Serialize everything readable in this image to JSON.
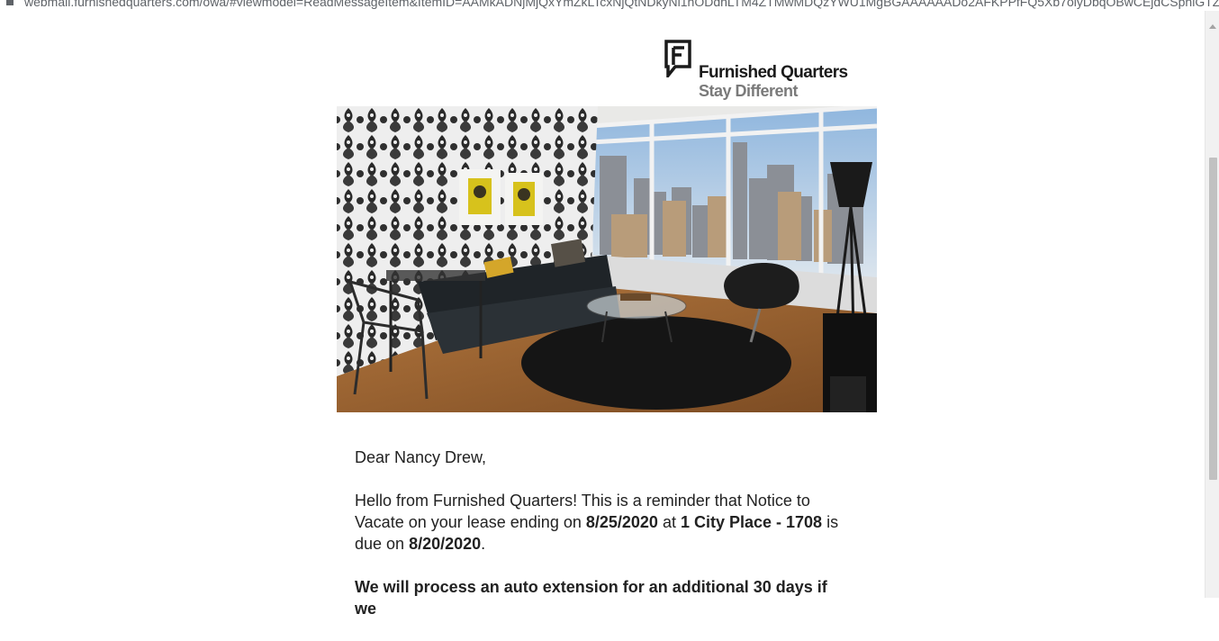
{
  "browser": {
    "url": "webmail.furnishedquarters.com/owa/#viewmodel=ReadMessageItem&ItemID=AAMkADNjMjQxYmZkLTcxNjQtNDkyNi1hODdhLTM4ZTMwMDQzYWU1MgBGAAAAAADo2AFKPPfFQ5Xb7oiyDbqOBwCEjdCSphlGTZ..."
  },
  "email": {
    "logo": {
      "name": "Furnished Quarters",
      "tagline": "Stay Different"
    },
    "greeting": "Dear Nancy Drew,",
    "para1": {
      "t1": "Hello from Furnished Quarters! This is a reminder that Notice to Vacate on your lease ending on ",
      "date_end": "8/25/2020",
      "t2": " at ",
      "address": "1 City Place - 1708",
      "t3": " is due on ",
      "date_due": "8/20/2020",
      "t4": "."
    },
    "para2_bold": "We will process an auto extension for an additional 30 days if we"
  },
  "colors": {
    "text": "#222222",
    "logo_dark": "#1a1a1a",
    "logo_grey": "#7a7a7a"
  }
}
